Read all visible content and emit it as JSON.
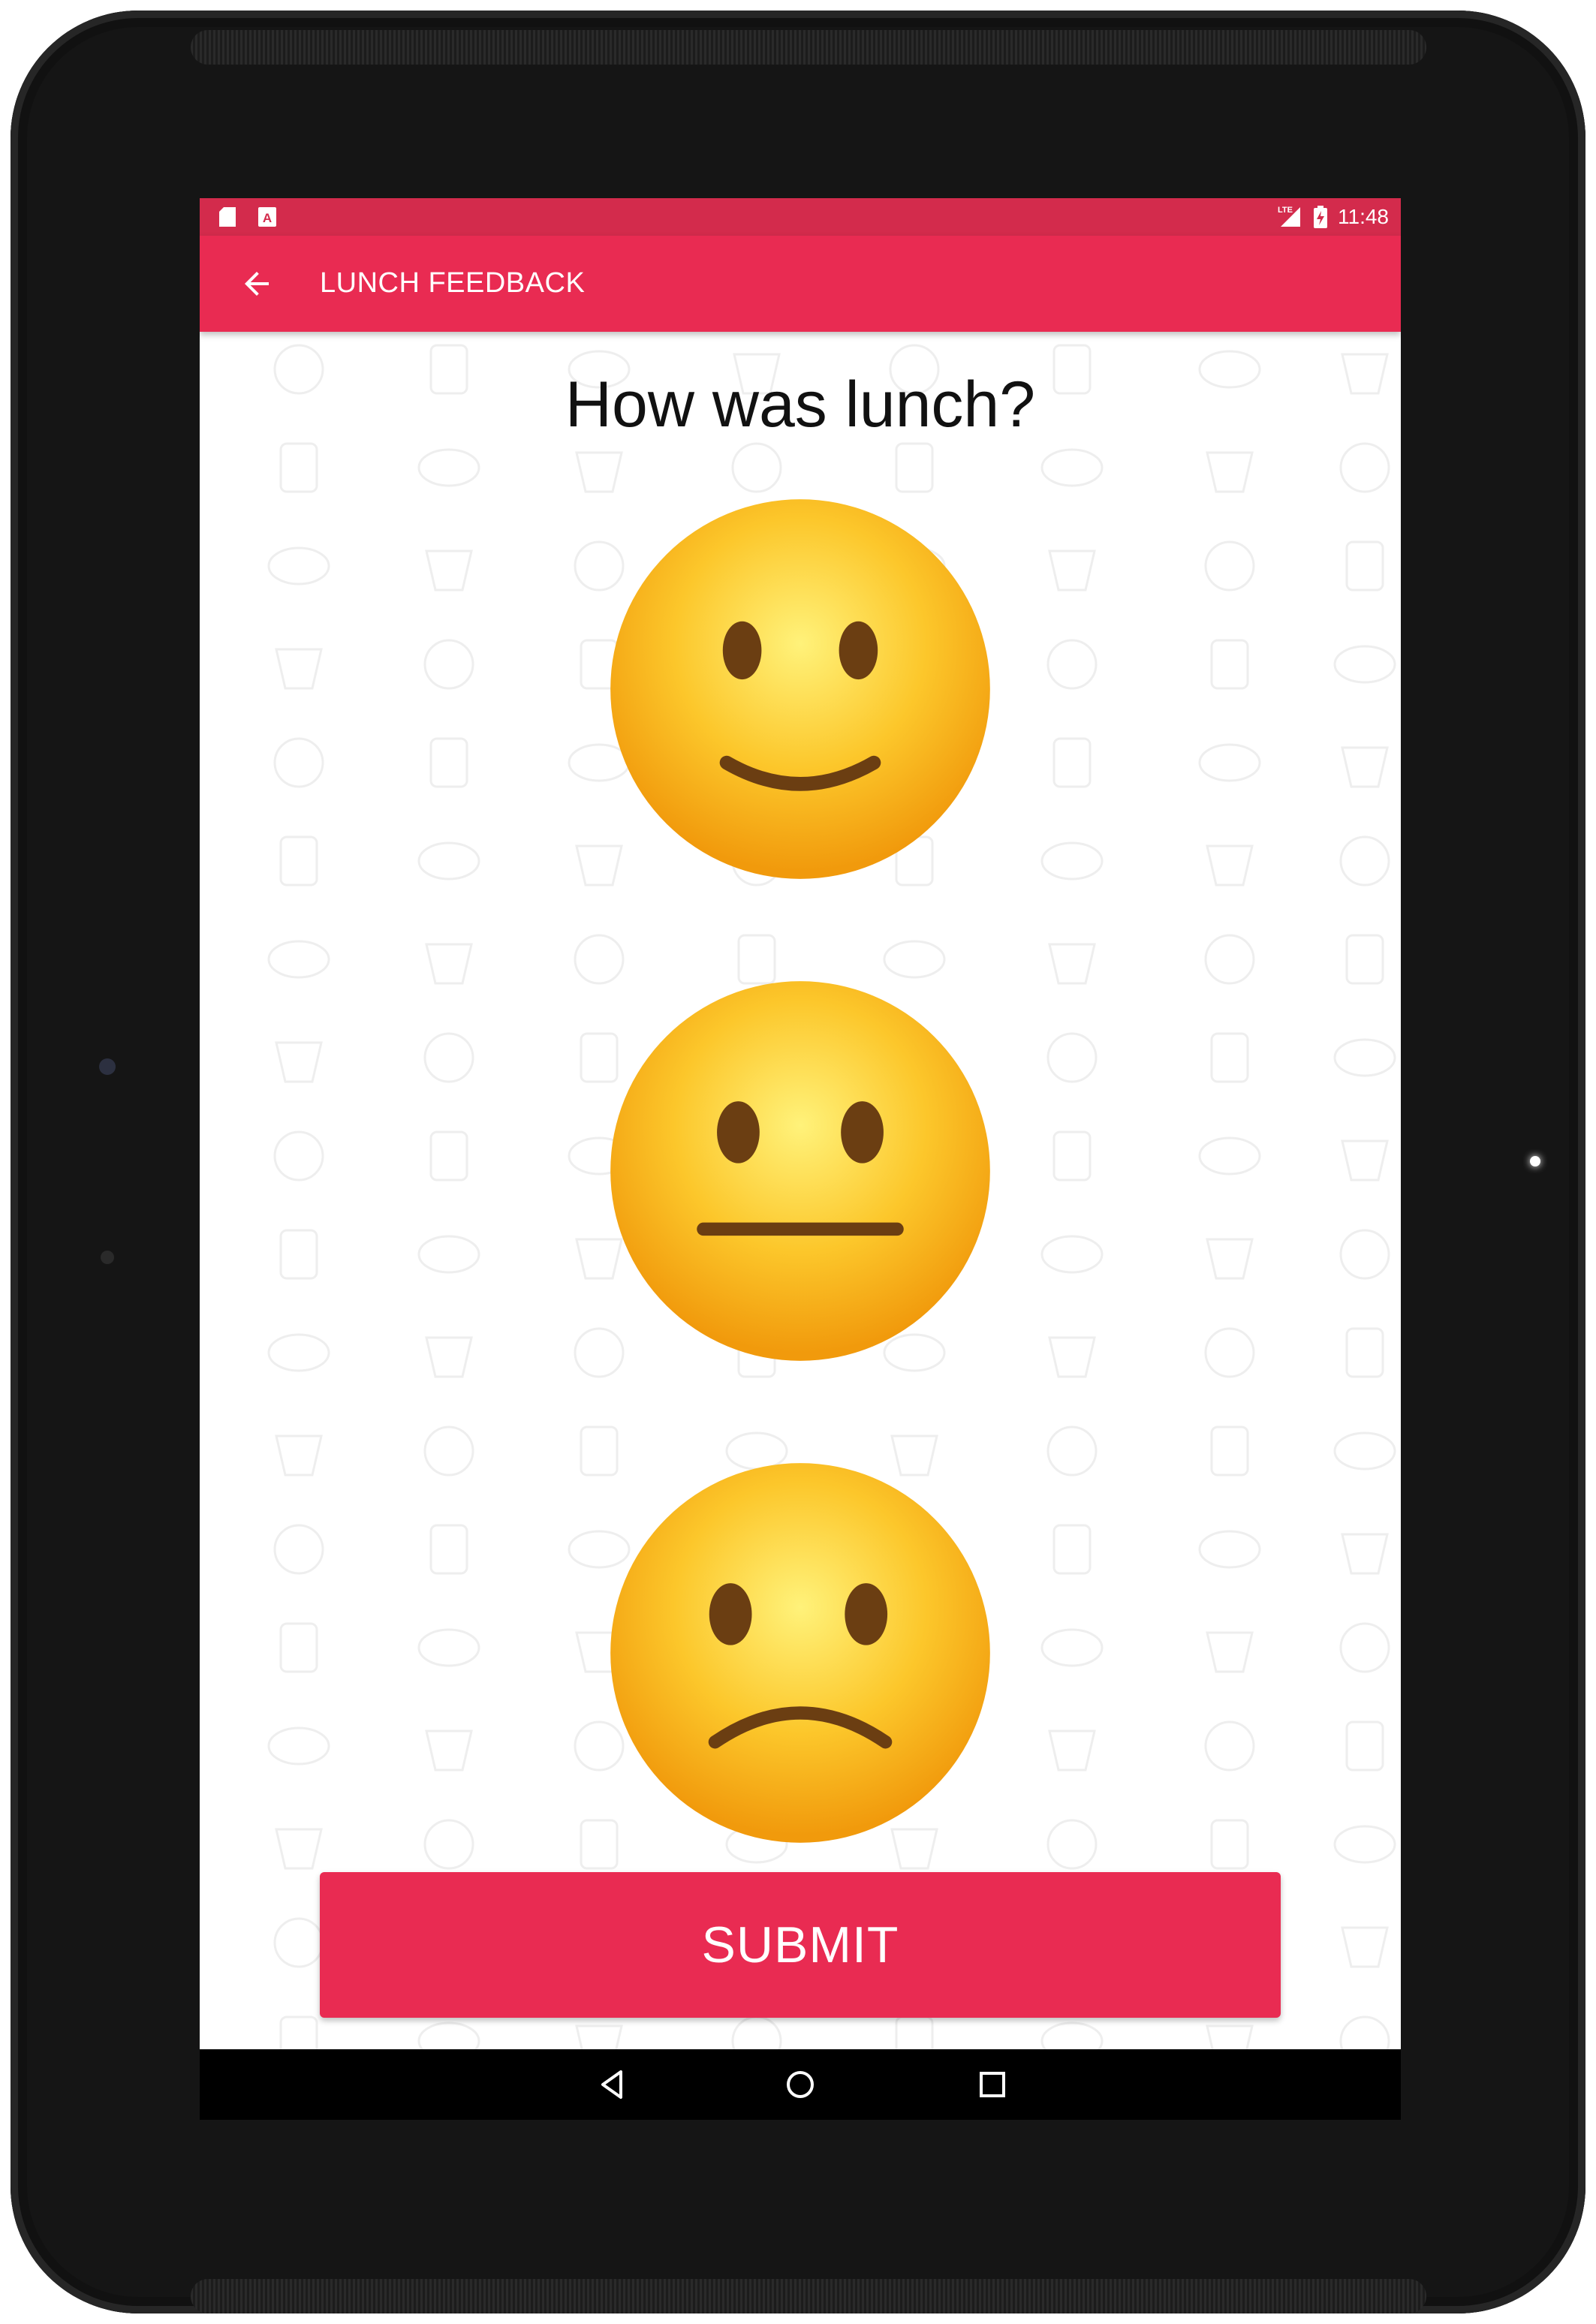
{
  "status_bar": {
    "time": "11:48",
    "left_icons": [
      "sd-card-icon",
      "keyboard-a-icon"
    ],
    "right_icons": [
      "lte-signal-icon",
      "battery-charging-icon"
    ]
  },
  "app_bar": {
    "title": "LUNCH FEEDBACK",
    "back_icon": "arrow-back-icon"
  },
  "main": {
    "question": "How was lunch?",
    "options": [
      {
        "icon": "slightly-smiling-face-icon"
      },
      {
        "icon": "neutral-face-icon"
      },
      {
        "icon": "slightly-frowning-face-icon"
      }
    ],
    "submit_label": "SUBMIT"
  },
  "nav_bar": {
    "buttons": [
      "back-triangle-icon",
      "home-circle-icon",
      "recents-square-icon"
    ]
  },
  "colors": {
    "status_bar": "#d32b4c",
    "app_bar": "#e92b52",
    "submit_button": "#e92b52",
    "nav_bar": "#000000",
    "emoji_face": "#fbc02d",
    "pattern_icons": "#eeeeee"
  }
}
